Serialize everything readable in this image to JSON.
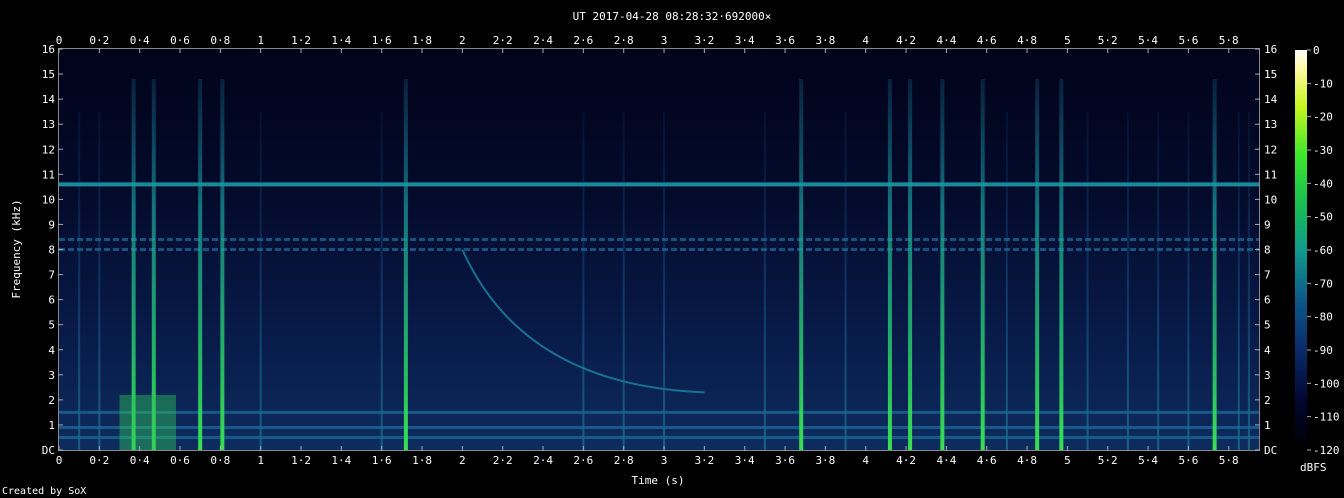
{
  "chart_data": {
    "type": "heatmap",
    "title": "UT 2017-04-28 08:28:32·692000×",
    "xlabel": "Time (s)",
    "ylabel": "Frequency (kHz)",
    "xlim": [
      0,
      5.95
    ],
    "ylim": [
      0,
      16
    ],
    "x_ticks": [
      "0",
      "0·2",
      "0·4",
      "0·6",
      "0·8",
      "1",
      "1·2",
      "1·4",
      "1·6",
      "1·8",
      "2",
      "2·2",
      "2·4",
      "2·6",
      "2·8",
      "3",
      "3·2",
      "3·4",
      "3·6",
      "3·8",
      "4",
      "4·2",
      "4·4",
      "4·6",
      "4·8",
      "5",
      "5·2",
      "5·4",
      "5·6",
      "5·8"
    ],
    "y_ticks": [
      "DC",
      "1",
      "2",
      "3",
      "4",
      "5",
      "6",
      "7",
      "8",
      "9",
      "10",
      "11",
      "12",
      "13",
      "14",
      "15",
      "16"
    ],
    "colorbar": {
      "label": "dBFS",
      "ticks": [
        "0",
        "-10",
        "-20",
        "-30",
        "-40",
        "-50",
        "-60",
        "-70",
        "-80",
        "-90",
        "-100",
        "-110",
        "-120"
      ],
      "range": [
        -120,
        0
      ]
    },
    "features": {
      "horizontal_lines_khz": [
        10.6,
        8.4,
        8.0,
        0.5,
        0.9,
        1.5
      ],
      "whistler_curve": {
        "start": [
          2.0,
          8.0
        ],
        "end": [
          3.2,
          2.3
        ]
      },
      "strong_impulses_s": [
        0.37,
        0.47,
        0.7,
        0.81,
        1.72,
        3.68,
        4.12,
        4.22,
        4.38,
        4.58,
        4.85,
        4.97,
        5.73
      ],
      "weak_impulses_s": [
        0.2,
        0.1,
        1.0,
        1.6,
        2.6,
        2.8,
        3.0,
        3.5,
        3.9,
        4.7,
        5.1,
        5.3,
        5.45,
        5.6,
        5.85,
        5.9
      ]
    }
  },
  "credit": "Created by SoX"
}
